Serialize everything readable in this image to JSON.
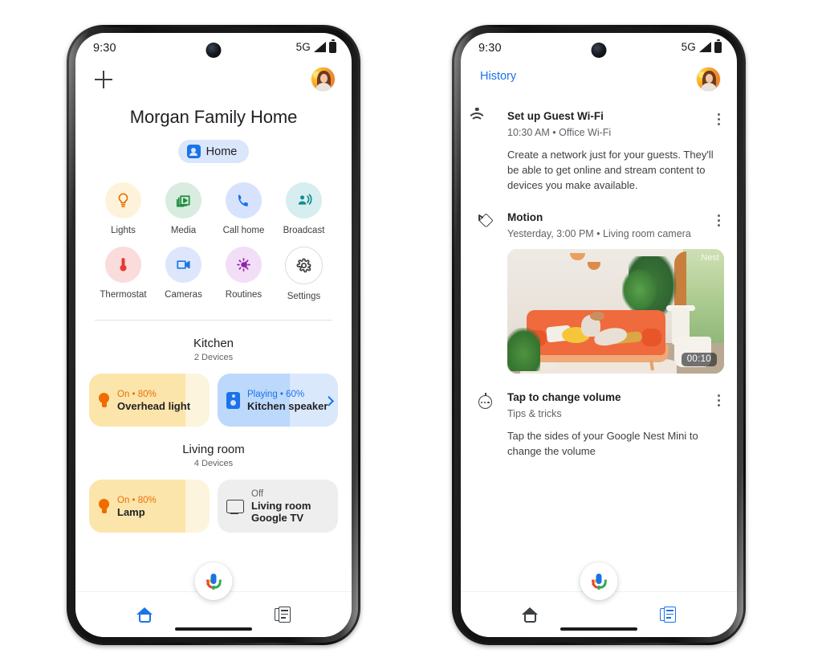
{
  "status_bar": {
    "time": "9:30",
    "network": "5G"
  },
  "home_screen": {
    "add_icon": "plus-icon",
    "avatar": "user-avatar",
    "title": "Morgan Family Home",
    "chip": {
      "label": "Home",
      "icon": "home-chip-icon",
      "bg": "#d9e6fb",
      "fg": "#1a73e8"
    },
    "shortcuts": [
      {
        "label": "Lights",
        "icon": "lightbulb-icon",
        "bg": "#fdf3da",
        "fg": "#e8710a"
      },
      {
        "label": "Media",
        "icon": "media-icon",
        "bg": "#d8ece0",
        "fg": "#1e8e3e"
      },
      {
        "label": "Call home",
        "icon": "phone-icon",
        "bg": "#d7e3fc",
        "fg": "#1a73e8"
      },
      {
        "label": "Broadcast",
        "icon": "broadcast-icon",
        "bg": "#d6eef0",
        "fg": "#128e8e"
      },
      {
        "label": "Thermostat",
        "icon": "thermostat-icon",
        "bg": "#fadcdc",
        "fg": "#e53935"
      },
      {
        "label": "Cameras",
        "icon": "camcorder-icon",
        "bg": "#dde6fb",
        "fg": "#1a73e8"
      },
      {
        "label": "Routines",
        "icon": "routines-icon",
        "bg": "#f2dff7",
        "fg": "#8e24aa"
      },
      {
        "label": "Settings",
        "icon": "gear-icon",
        "bg": "#ffffff",
        "fg": "#3c4043"
      }
    ],
    "rooms": [
      {
        "name": "Kitchen",
        "device_count": "2 Devices",
        "devices": [
          {
            "state": "On • 80%",
            "name": "Overhead light",
            "icon": "lightbulb-icon",
            "fill_percent": 80,
            "fill_color": "#fce5ab",
            "track_color": "#fdf4dd",
            "state_color": "#e8710a",
            "chevron": false
          },
          {
            "state": "Playing • 60%",
            "name": "Kitchen speaker",
            "icon": "speaker-icon",
            "fill_percent": 60,
            "fill_color": "#bcd8fb",
            "track_color": "#dae8fc",
            "state_color": "#1a73e8",
            "chevron": true
          }
        ]
      },
      {
        "name": "Living room",
        "device_count": "4 Devices",
        "devices": [
          {
            "state": "On • 80%",
            "name": "Lamp",
            "icon": "lightbulb-icon",
            "fill_percent": 80,
            "fill_color": "#fce5ab",
            "track_color": "#fdf4dd",
            "state_color": "#e8710a",
            "chevron": false
          },
          {
            "state": "Off",
            "name": "Living room\nGoogle TV",
            "name_line1": "Living room",
            "name_line2": "Google TV",
            "icon": "tv-icon",
            "fill_percent": 0,
            "fill_color": "#eeeeee",
            "track_color": "#eeeeee",
            "state_color": "#5f6368",
            "chevron": false
          }
        ]
      }
    ],
    "nav": [
      {
        "label": "Home",
        "icon": "home-icon",
        "active": true,
        "color": "#1a73e8"
      },
      {
        "label": "Feed",
        "icon": "feed-icon",
        "active": false,
        "color": "#3c4043"
      }
    ],
    "assistant_fab": "assistant-mic-icon"
  },
  "history_screen": {
    "header_label": "History",
    "avatar": "user-avatar",
    "cards": [
      {
        "icon": "wifi-icon",
        "title": "Set up Guest Wi-Fi",
        "meta": "10:30 AM • Office Wi-Fi",
        "description": "Create a network just for your guests. They'll be able to get online and stream content to devices you make available.",
        "menu": "kebab-menu-icon"
      },
      {
        "icon": "motion-icon",
        "title": "Motion",
        "meta": "Yesterday, 3:00 PM • Living room camera",
        "thumbnail": {
          "duration": "00:10",
          "watermark": "Nest"
        },
        "menu": "kebab-menu-icon"
      },
      {
        "icon": "tips-icon",
        "title": "Tap to change volume",
        "meta": "Tips & tricks",
        "description": "Tap the sides of your Google Nest Mini to change the volume",
        "menu": "kebab-menu-icon"
      }
    ],
    "nav": [
      {
        "label": "Home",
        "icon": "home-icon",
        "active": false,
        "color": "#3c4043"
      },
      {
        "label": "Feed",
        "icon": "feed-icon",
        "active": true,
        "color": "#1a73e8"
      }
    ],
    "assistant_fab": "assistant-mic-icon"
  }
}
